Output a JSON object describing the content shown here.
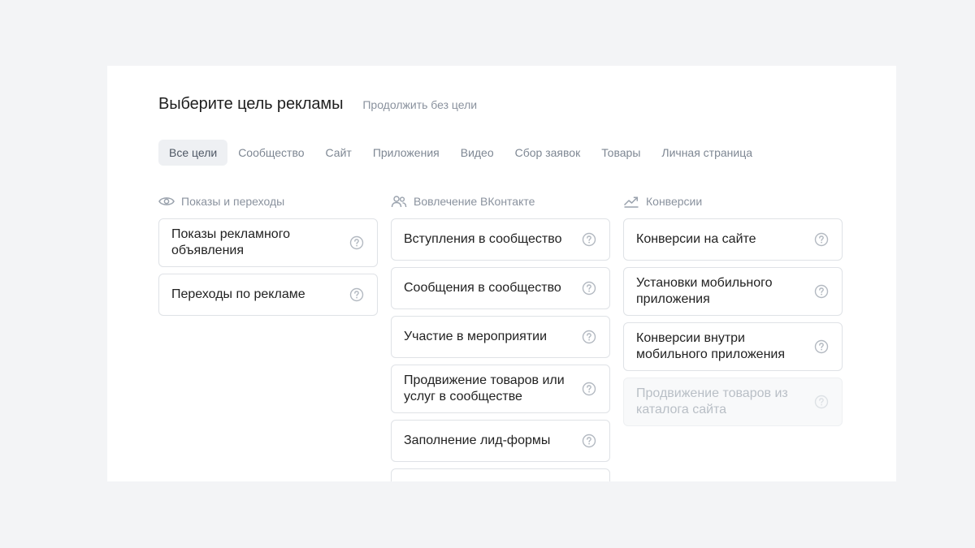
{
  "header": {
    "title": "Выберите цель рекламы",
    "skip_link": "Продолжить без цели"
  },
  "tabs": [
    {
      "label": "Все цели",
      "active": true
    },
    {
      "label": "Сообщество"
    },
    {
      "label": "Сайт"
    },
    {
      "label": "Приложения"
    },
    {
      "label": "Видео"
    },
    {
      "label": "Сбор заявок"
    },
    {
      "label": "Товары"
    },
    {
      "label": "Личная страница"
    }
  ],
  "columns": [
    {
      "title": "Показы и переходы",
      "icon": "eye-icon",
      "items": [
        {
          "label": "Показы рекламного объявления"
        },
        {
          "label": "Переходы по рекламе"
        }
      ]
    },
    {
      "title": "Вовлечение ВКонтакте",
      "icon": "users-icon",
      "items": [
        {
          "label": "Вступления в сообщество"
        },
        {
          "label": "Сообщения в сообщество"
        },
        {
          "label": "Участие в мероприятии"
        },
        {
          "label": "Продвижение товаров или услуг в сообществе"
        },
        {
          "label": "Заполнение лид-формы"
        }
      ]
    },
    {
      "title": "Конверсии",
      "icon": "trend-up-icon",
      "items": [
        {
          "label": "Конверсии на сайте"
        },
        {
          "label": "Установки мобильного приложения"
        },
        {
          "label": "Конверсии внутри мобильного приложения"
        },
        {
          "label": "Продвижение товаров из каталога сайта",
          "disabled": true
        }
      ]
    }
  ],
  "colors": {
    "page_bg": "#f3f4f6",
    "panel_bg": "#ffffff",
    "card_border": "#dfe2e6",
    "muted_text": "#8a929e",
    "active_tab_bg": "#eef0f3"
  }
}
